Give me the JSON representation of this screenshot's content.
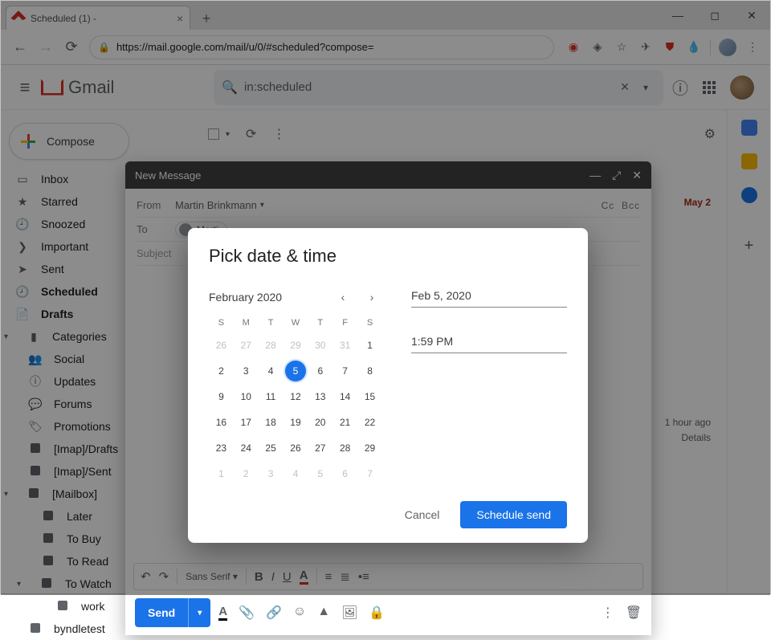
{
  "browser": {
    "tab_title": "Scheduled (1) -",
    "url": "https://mail.google.com/mail/u/0/#scheduled?compose="
  },
  "gmail": {
    "product": "Gmail",
    "search_term": "in:scheduled",
    "compose_label": "Compose"
  },
  "sidebar": {
    "items": [
      {
        "label": "Inbox"
      },
      {
        "label": "Starred"
      },
      {
        "label": "Snoozed"
      },
      {
        "label": "Important"
      },
      {
        "label": "Sent"
      },
      {
        "label": "Scheduled"
      },
      {
        "label": "Drafts"
      },
      {
        "label": "Categories"
      },
      {
        "label": "Social"
      },
      {
        "label": "Updates"
      },
      {
        "label": "Forums"
      },
      {
        "label": "Promotions"
      },
      {
        "label": "[Imap]/Drafts"
      },
      {
        "label": "[Imap]/Sent"
      },
      {
        "label": "[Mailbox]"
      },
      {
        "label": "Later"
      },
      {
        "label": "To Buy"
      },
      {
        "label": "To Read"
      },
      {
        "label": "To Watch"
      },
      {
        "label": "work"
      },
      {
        "label": "byndletest"
      }
    ]
  },
  "list": {
    "date_badge": "May 2",
    "activity_line1": "1 hour ago",
    "activity_line2": "Details"
  },
  "compose": {
    "title": "New Message",
    "from_label": "From",
    "from_value": "Martin Brinkmann",
    "to_label": "To",
    "to_chip": "Marti",
    "cc": "Cc",
    "bcc": "Bcc",
    "subject_label": "Subject",
    "send_label": "Send"
  },
  "dialog": {
    "title": "Pick date & time",
    "month_label": "February 2020",
    "weekdays": [
      "S",
      "M",
      "T",
      "W",
      "T",
      "F",
      "S"
    ],
    "grid": [
      [
        {
          "n": 26,
          "dim": 1
        },
        {
          "n": 27,
          "dim": 1
        },
        {
          "n": 28,
          "dim": 1
        },
        {
          "n": 29,
          "dim": 1
        },
        {
          "n": 30,
          "dim": 1
        },
        {
          "n": 31,
          "dim": 1
        },
        {
          "n": 1
        }
      ],
      [
        {
          "n": 2
        },
        {
          "n": 3
        },
        {
          "n": 4
        },
        {
          "n": 5,
          "sel": 1
        },
        {
          "n": 6
        },
        {
          "n": 7
        },
        {
          "n": 8
        }
      ],
      [
        {
          "n": 9
        },
        {
          "n": 10
        },
        {
          "n": 11
        },
        {
          "n": 12
        },
        {
          "n": 13
        },
        {
          "n": 14
        },
        {
          "n": 15
        }
      ],
      [
        {
          "n": 16
        },
        {
          "n": 17
        },
        {
          "n": 18
        },
        {
          "n": 19
        },
        {
          "n": 20
        },
        {
          "n": 21
        },
        {
          "n": 22
        }
      ],
      [
        {
          "n": 23
        },
        {
          "n": 24
        },
        {
          "n": 25
        },
        {
          "n": 26
        },
        {
          "n": 27
        },
        {
          "n": 28
        },
        {
          "n": 29
        }
      ],
      [
        {
          "n": 1,
          "dim": 1
        },
        {
          "n": 2,
          "dim": 1
        },
        {
          "n": 3,
          "dim": 1
        },
        {
          "n": 4,
          "dim": 1
        },
        {
          "n": 5,
          "dim": 1
        },
        {
          "n": 6,
          "dim": 1
        },
        {
          "n": 7,
          "dim": 1
        }
      ]
    ],
    "date_input": "Feb 5, 2020",
    "time_input": "1:59 PM",
    "cancel_label": "Cancel",
    "schedule_label": "Schedule send"
  }
}
